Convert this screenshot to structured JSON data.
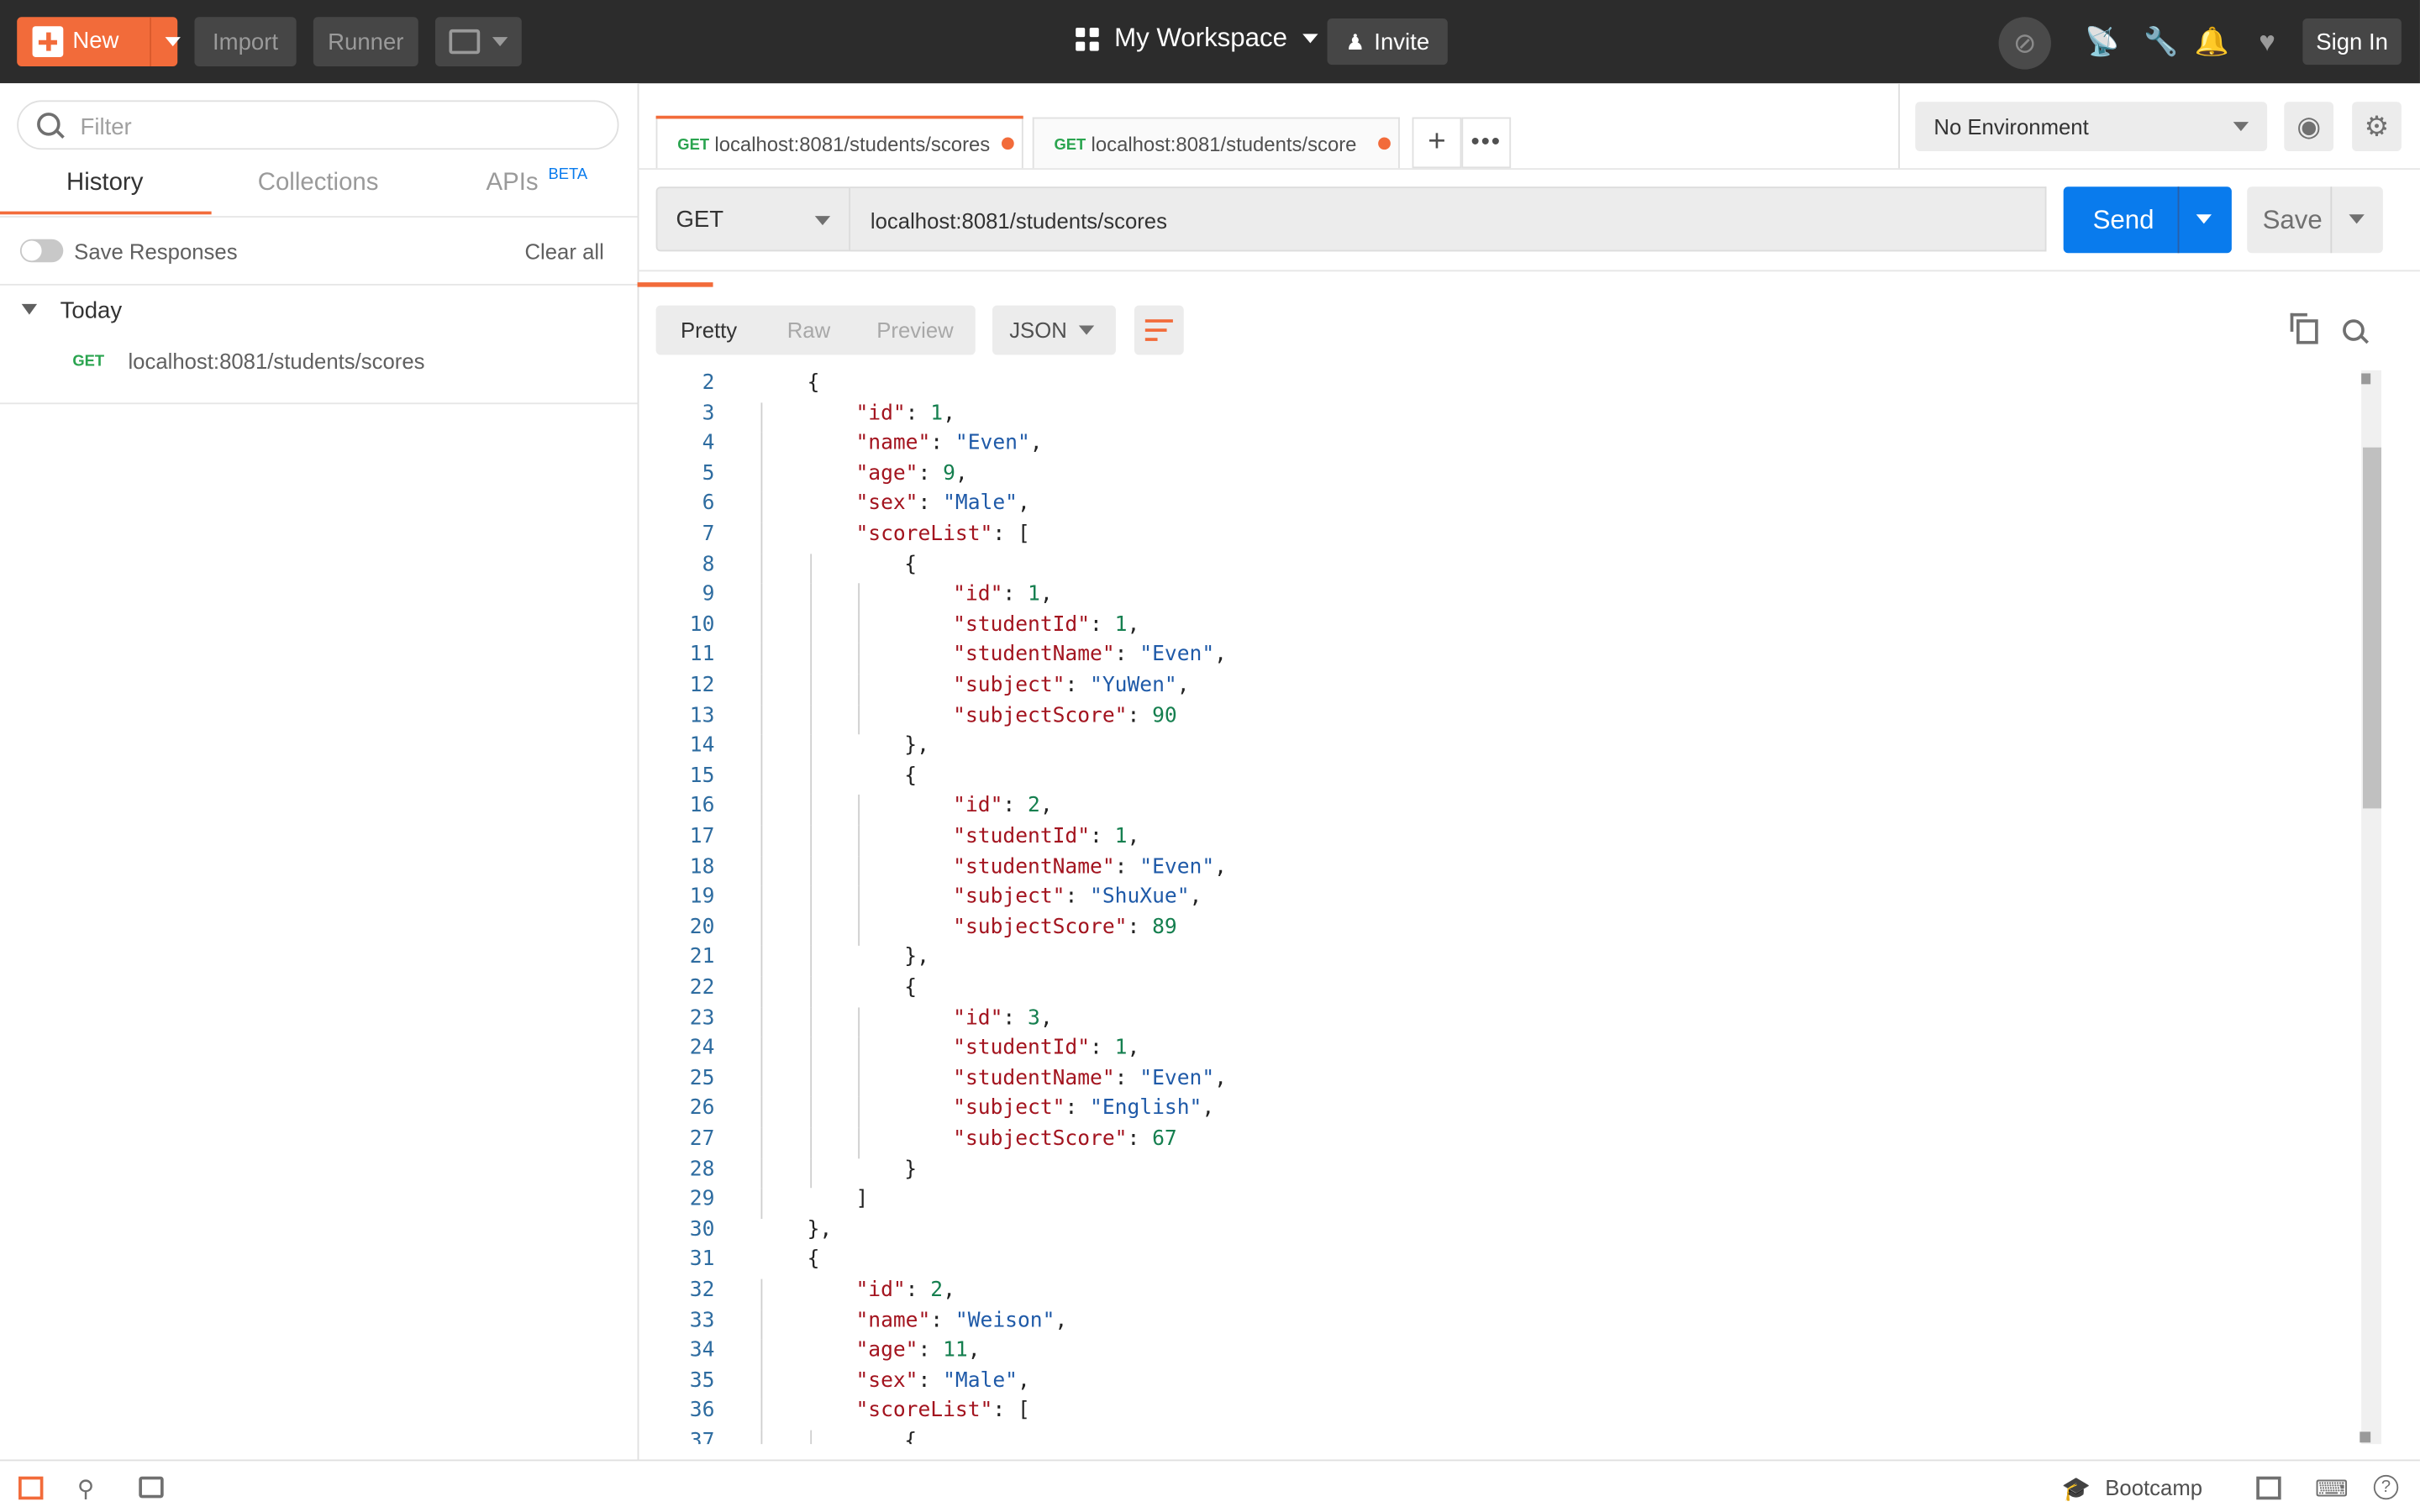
{
  "topbar": {
    "new_label": "New",
    "import_label": "Import",
    "runner_label": "Runner",
    "workspace_label": "My Workspace",
    "invite_label": "Invite",
    "signin_label": "Sign In"
  },
  "sidebar": {
    "filter_placeholder": "Filter",
    "tabs": [
      "History",
      "Collections",
      "APIs"
    ],
    "apis_badge": "BETA",
    "save_responses_label": "Save Responses",
    "clear_all_label": "Clear all",
    "group_label": "Today",
    "history": [
      {
        "method": "GET",
        "url": "localhost:8081/students/scores"
      }
    ]
  },
  "request_tabs": [
    {
      "method": "GET",
      "url": "localhost:8081/students/scores",
      "active": true
    },
    {
      "method": "GET",
      "url": "localhost:8081/students/score",
      "active": false
    }
  ],
  "environment": {
    "selected": "No Environment"
  },
  "request": {
    "method": "GET",
    "url": "localhost:8081/students/scores",
    "send_label": "Send",
    "save_label": "Save"
  },
  "response": {
    "view_tabs": [
      "Pretty",
      "Raw",
      "Preview"
    ],
    "active_view": "Pretty",
    "format": "JSON",
    "lines": [
      {
        "n": 2,
        "indent": 1,
        "tokens": [
          [
            "p",
            "{"
          ]
        ]
      },
      {
        "n": 3,
        "indent": 2,
        "tokens": [
          [
            "k",
            "\"id\""
          ],
          [
            "p",
            ": "
          ],
          [
            "n",
            "1"
          ],
          [
            "p",
            ","
          ]
        ]
      },
      {
        "n": 4,
        "indent": 2,
        "tokens": [
          [
            "k",
            "\"name\""
          ],
          [
            "p",
            ": "
          ],
          [
            "s",
            "\"Even\""
          ],
          [
            "p",
            ","
          ]
        ]
      },
      {
        "n": 5,
        "indent": 2,
        "tokens": [
          [
            "k",
            "\"age\""
          ],
          [
            "p",
            ": "
          ],
          [
            "n",
            "9"
          ],
          [
            "p",
            ","
          ]
        ]
      },
      {
        "n": 6,
        "indent": 2,
        "tokens": [
          [
            "k",
            "\"sex\""
          ],
          [
            "p",
            ": "
          ],
          [
            "s",
            "\"Male\""
          ],
          [
            "p",
            ","
          ]
        ]
      },
      {
        "n": 7,
        "indent": 2,
        "tokens": [
          [
            "k",
            "\"scoreList\""
          ],
          [
            "p",
            ": ["
          ]
        ]
      },
      {
        "n": 8,
        "indent": 3,
        "tokens": [
          [
            "p",
            "{"
          ]
        ]
      },
      {
        "n": 9,
        "indent": 4,
        "tokens": [
          [
            "k",
            "\"id\""
          ],
          [
            "p",
            ": "
          ],
          [
            "n",
            "1"
          ],
          [
            "p",
            ","
          ]
        ]
      },
      {
        "n": 10,
        "indent": 4,
        "tokens": [
          [
            "k",
            "\"studentId\""
          ],
          [
            "p",
            ": "
          ],
          [
            "n",
            "1"
          ],
          [
            "p",
            ","
          ]
        ]
      },
      {
        "n": 11,
        "indent": 4,
        "tokens": [
          [
            "k",
            "\"studentName\""
          ],
          [
            "p",
            ": "
          ],
          [
            "s",
            "\"Even\""
          ],
          [
            "p",
            ","
          ]
        ]
      },
      {
        "n": 12,
        "indent": 4,
        "tokens": [
          [
            "k",
            "\"subject\""
          ],
          [
            "p",
            ": "
          ],
          [
            "s",
            "\"YuWen\""
          ],
          [
            "p",
            ","
          ]
        ]
      },
      {
        "n": 13,
        "indent": 4,
        "tokens": [
          [
            "k",
            "\"subjectScore\""
          ],
          [
            "p",
            ": "
          ],
          [
            "n",
            "90"
          ]
        ]
      },
      {
        "n": 14,
        "indent": 3,
        "tokens": [
          [
            "p",
            "},"
          ]
        ]
      },
      {
        "n": 15,
        "indent": 3,
        "tokens": [
          [
            "p",
            "{"
          ]
        ]
      },
      {
        "n": 16,
        "indent": 4,
        "tokens": [
          [
            "k",
            "\"id\""
          ],
          [
            "p",
            ": "
          ],
          [
            "n",
            "2"
          ],
          [
            "p",
            ","
          ]
        ]
      },
      {
        "n": 17,
        "indent": 4,
        "tokens": [
          [
            "k",
            "\"studentId\""
          ],
          [
            "p",
            ": "
          ],
          [
            "n",
            "1"
          ],
          [
            "p",
            ","
          ]
        ]
      },
      {
        "n": 18,
        "indent": 4,
        "tokens": [
          [
            "k",
            "\"studentName\""
          ],
          [
            "p",
            ": "
          ],
          [
            "s",
            "\"Even\""
          ],
          [
            "p",
            ","
          ]
        ]
      },
      {
        "n": 19,
        "indent": 4,
        "tokens": [
          [
            "k",
            "\"subject\""
          ],
          [
            "p",
            ": "
          ],
          [
            "s",
            "\"ShuXue\""
          ],
          [
            "p",
            ","
          ]
        ]
      },
      {
        "n": 20,
        "indent": 4,
        "tokens": [
          [
            "k",
            "\"subjectScore\""
          ],
          [
            "p",
            ": "
          ],
          [
            "n",
            "89"
          ]
        ]
      },
      {
        "n": 21,
        "indent": 3,
        "tokens": [
          [
            "p",
            "},"
          ]
        ]
      },
      {
        "n": 22,
        "indent": 3,
        "tokens": [
          [
            "p",
            "{"
          ]
        ]
      },
      {
        "n": 23,
        "indent": 4,
        "tokens": [
          [
            "k",
            "\"id\""
          ],
          [
            "p",
            ": "
          ],
          [
            "n",
            "3"
          ],
          [
            "p",
            ","
          ]
        ]
      },
      {
        "n": 24,
        "indent": 4,
        "tokens": [
          [
            "k",
            "\"studentId\""
          ],
          [
            "p",
            ": "
          ],
          [
            "n",
            "1"
          ],
          [
            "p",
            ","
          ]
        ]
      },
      {
        "n": 25,
        "indent": 4,
        "tokens": [
          [
            "k",
            "\"studentName\""
          ],
          [
            "p",
            ": "
          ],
          [
            "s",
            "\"Even\""
          ],
          [
            "p",
            ","
          ]
        ]
      },
      {
        "n": 26,
        "indent": 4,
        "tokens": [
          [
            "k",
            "\"subject\""
          ],
          [
            "p",
            ": "
          ],
          [
            "s",
            "\"English\""
          ],
          [
            "p",
            ","
          ]
        ]
      },
      {
        "n": 27,
        "indent": 4,
        "tokens": [
          [
            "k",
            "\"subjectScore\""
          ],
          [
            "p",
            ": "
          ],
          [
            "n",
            "67"
          ]
        ]
      },
      {
        "n": 28,
        "indent": 3,
        "tokens": [
          [
            "p",
            "}"
          ]
        ]
      },
      {
        "n": 29,
        "indent": 2,
        "tokens": [
          [
            "p",
            "]"
          ]
        ]
      },
      {
        "n": 30,
        "indent": 1,
        "tokens": [
          [
            "p",
            "},"
          ]
        ]
      },
      {
        "n": 31,
        "indent": 1,
        "tokens": [
          [
            "p",
            "{"
          ]
        ]
      },
      {
        "n": 32,
        "indent": 2,
        "tokens": [
          [
            "k",
            "\"id\""
          ],
          [
            "p",
            ": "
          ],
          [
            "n",
            "2"
          ],
          [
            "p",
            ","
          ]
        ]
      },
      {
        "n": 33,
        "indent": 2,
        "tokens": [
          [
            "k",
            "\"name\""
          ],
          [
            "p",
            ": "
          ],
          [
            "s",
            "\"Weison\""
          ],
          [
            "p",
            ","
          ]
        ]
      },
      {
        "n": 34,
        "indent": 2,
        "tokens": [
          [
            "k",
            "\"age\""
          ],
          [
            "p",
            ": "
          ],
          [
            "n",
            "11"
          ],
          [
            "p",
            ","
          ]
        ]
      },
      {
        "n": 35,
        "indent": 2,
        "tokens": [
          [
            "k",
            "\"sex\""
          ],
          [
            "p",
            ": "
          ],
          [
            "s",
            "\"Male\""
          ],
          [
            "p",
            ","
          ]
        ]
      },
      {
        "n": 36,
        "indent": 2,
        "tokens": [
          [
            "k",
            "\"scoreList\""
          ],
          [
            "p",
            ": ["
          ]
        ]
      },
      {
        "n": 37,
        "indent": 3,
        "tokens": [
          [
            "p",
            "{"
          ]
        ]
      }
    ]
  },
  "statusbar": {
    "bootcamp_label": "Bootcamp"
  },
  "colors": {
    "accent": "#f26b3a",
    "send": "#097bed",
    "key": "#a3141f",
    "string": "#1f5aa8",
    "number": "#157f4f",
    "get": "#2aa44f"
  }
}
